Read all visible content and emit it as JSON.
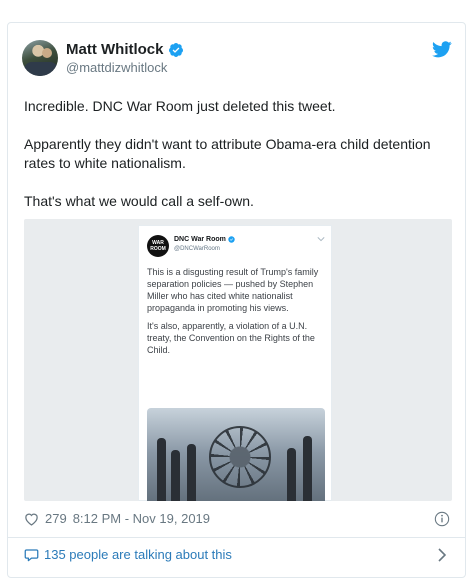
{
  "author": {
    "name": "Matt Whitlock",
    "handle": "@mattdizwhitlock"
  },
  "tweet": {
    "paragraphs": [
      "Incredible. DNC War Room just deleted this tweet.",
      "Apparently they didn't want to attribute Obama-era child detention rates to white nationalism.",
      "That's what we would call a self-own."
    ]
  },
  "embedded_tweet": {
    "logo_text": "WAR ROOM",
    "name": "DNC War Room",
    "handle": "@DNCWarRoom",
    "paragraphs": [
      "This is a disgusting result of Trump's family separation policies — pushed by Stephen Miller who has cited white nationalist propaganda in promoting his views.",
      "It's also, apparently, a violation of a U.N. treaty, the Convention on the Rights of the Child."
    ]
  },
  "footer": {
    "like_count": "279",
    "timestamp": "8:12 PM - Nov 19, 2019",
    "talking_text": "135 people are talking about this"
  },
  "icons": {
    "verified": "verified-badge-icon",
    "twitter": "twitter-bird-icon",
    "like": "heart-icon",
    "info": "info-icon",
    "comment": "comment-bubble-icon",
    "chevron": "chevron-right-icon"
  },
  "colors": {
    "accent": "#1da1f2",
    "link": "#2b7bb9",
    "muted": "#697882"
  }
}
